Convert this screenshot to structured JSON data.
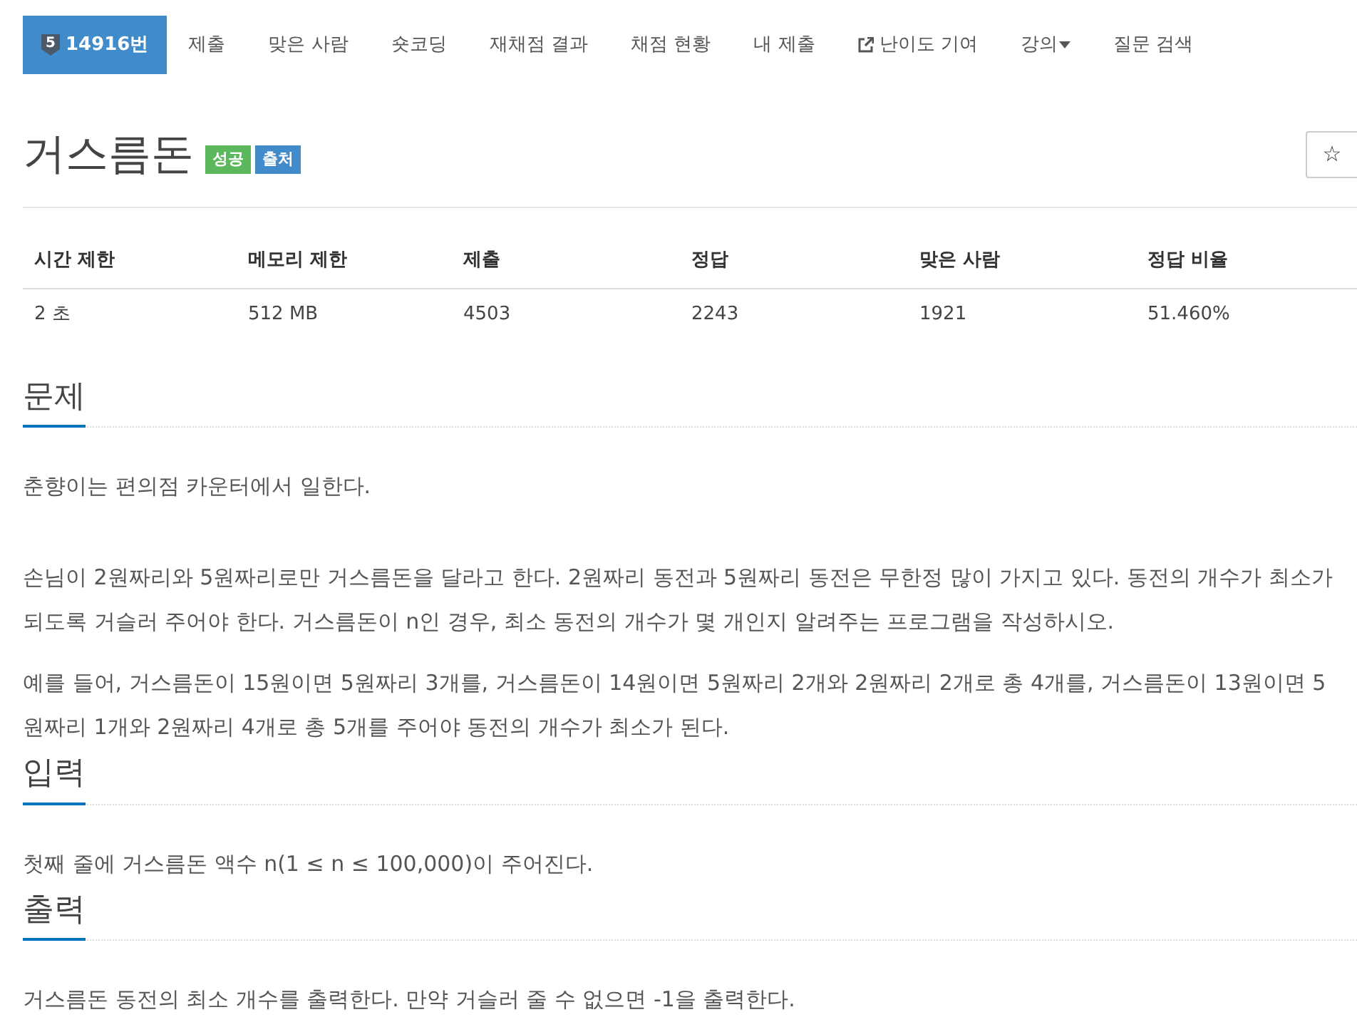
{
  "navbar": {
    "items": [
      {
        "kind": "problem",
        "tier": "5",
        "label": "14916번",
        "selected": true
      },
      {
        "kind": "link",
        "label": "제출",
        "selected": false
      },
      {
        "kind": "link",
        "label": "맞은 사람",
        "selected": false
      },
      {
        "kind": "link",
        "label": "숏코딩",
        "selected": false
      },
      {
        "kind": "link",
        "label": "재채점 결과",
        "selected": false
      },
      {
        "kind": "link",
        "label": "채점 현황",
        "selected": false
      },
      {
        "kind": "link",
        "label": "내 제출",
        "selected": false
      },
      {
        "kind": "external",
        "label": "난이도 기여",
        "selected": false
      },
      {
        "kind": "dropdown",
        "label": "강의",
        "selected": false
      },
      {
        "kind": "link",
        "label": "질문 검색",
        "selected": false
      }
    ]
  },
  "title": "거스름돈",
  "badges": [
    {
      "label": "성공",
      "color": "#5cb85c"
    },
    {
      "label": "출처",
      "color": "#428bca"
    }
  ],
  "star_button": {
    "label": "☆"
  },
  "stats_table": {
    "columns": [
      "시간 제한",
      "메모리 제한",
      "제출",
      "정답",
      "맞은 사람",
      "정답 비율"
    ],
    "rows": [
      [
        "2 초",
        "512 MB",
        "4503",
        "2243",
        "1921",
        "51.460%"
      ]
    ]
  },
  "sections": [
    {
      "heading": "문제",
      "paragraphs": [
        "춘향이는 편의점 카운터에서 일한다.",
        "손님이 2원짜리와 5원짜리로만 거스름돈을 달라고 한다. 2원짜리 동전과 5원짜리 동전은 무한정 많이 가지고 있다. 동전의 개수가 최소가 되도록 거슬러 주어야 한다. 거스름돈이 n인 경우, 최소 동전의 개수가 몇 개인지 알려주는 프로그램을 작성하시오.",
        "예를 들어, 거스름돈이 15원이면 5원짜리 3개를, 거스름돈이 14원이면 5원짜리 2개와 2원짜리 2개로 총 4개를, 거스름돈이 13원이면 5원짜리 1개와 2원짜리 4개로 총 5개를 주어야 동전의 개수가 최소가 된다."
      ]
    },
    {
      "heading": "입력",
      "paragraphs": [
        "첫째 줄에 거스름돈 액수 n(1 ≤ n ≤ 100,000)이 주어진다."
      ]
    },
    {
      "heading": "출력",
      "paragraphs": [
        "거스름돈 동전의 최소 개수를 출력한다. 만약 거슬러 줄 수 없으면 -1을 출력한다."
      ]
    }
  ]
}
